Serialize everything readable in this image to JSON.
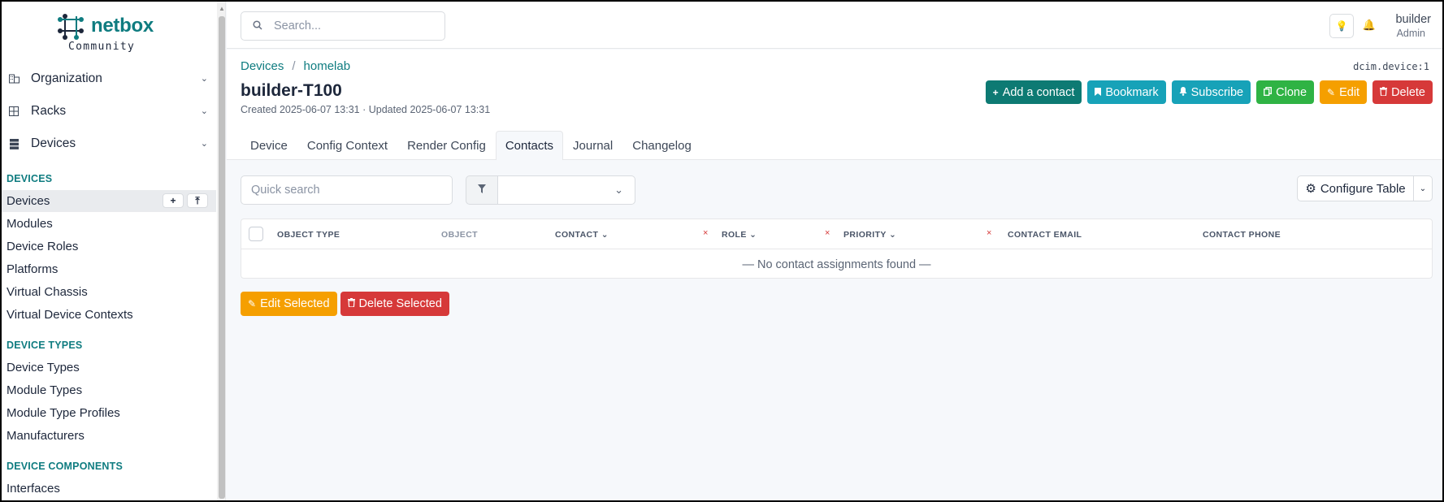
{
  "brand": {
    "name": "netbox",
    "edition": "Community"
  },
  "sidebar": {
    "top_menus": [
      {
        "label": "Organization",
        "icon": "building-icon"
      },
      {
        "label": "Racks",
        "icon": "rack-icon"
      },
      {
        "label": "Devices",
        "icon": "server-icon"
      }
    ],
    "sections": [
      {
        "heading": "DEVICES",
        "items": [
          "Devices",
          "Modules",
          "Device Roles",
          "Platforms",
          "Virtual Chassis",
          "Virtual Device Contexts"
        ]
      },
      {
        "heading": "DEVICE TYPES",
        "items": [
          "Device Types",
          "Module Types",
          "Module Type Profiles",
          "Manufacturers"
        ]
      },
      {
        "heading": "DEVICE COMPONENTS",
        "items": [
          "Interfaces"
        ]
      }
    ],
    "active_item": "Devices"
  },
  "header": {
    "search_placeholder": "Search...",
    "user": {
      "name": "builder",
      "role": "Admin"
    }
  },
  "page": {
    "breadcrumb": [
      "Devices",
      "homelab"
    ],
    "object_id": "dcim.device:1",
    "title": "builder-T100",
    "meta": "Created 2025-06-07 13:31 · Updated 2025-06-07 13:31",
    "actions": {
      "add_contact": "Add a contact",
      "bookmark": "Bookmark",
      "subscribe": "Subscribe",
      "clone": "Clone",
      "edit": "Edit",
      "delete": "Delete"
    },
    "tabs": [
      "Device",
      "Config Context",
      "Render Config",
      "Contacts",
      "Journal",
      "Changelog"
    ],
    "active_tab": "Contacts"
  },
  "table": {
    "quick_search_placeholder": "Quick search",
    "configure_label": "Configure Table",
    "columns": [
      "OBJECT TYPE",
      "OBJECT",
      "CONTACT",
      "ROLE",
      "PRIORITY",
      "CONTACT EMAIL",
      "CONTACT PHONE"
    ],
    "empty_text": "— No contact assignments found —"
  },
  "bulk_actions": {
    "edit": "Edit Selected",
    "delete": "Delete Selected"
  },
  "colors": {
    "brand": "#0f7c80",
    "teal": "#0d7a73",
    "cyan": "#17a2b8",
    "green": "#2fb344",
    "orange": "#f59f00",
    "red": "#d63939"
  }
}
